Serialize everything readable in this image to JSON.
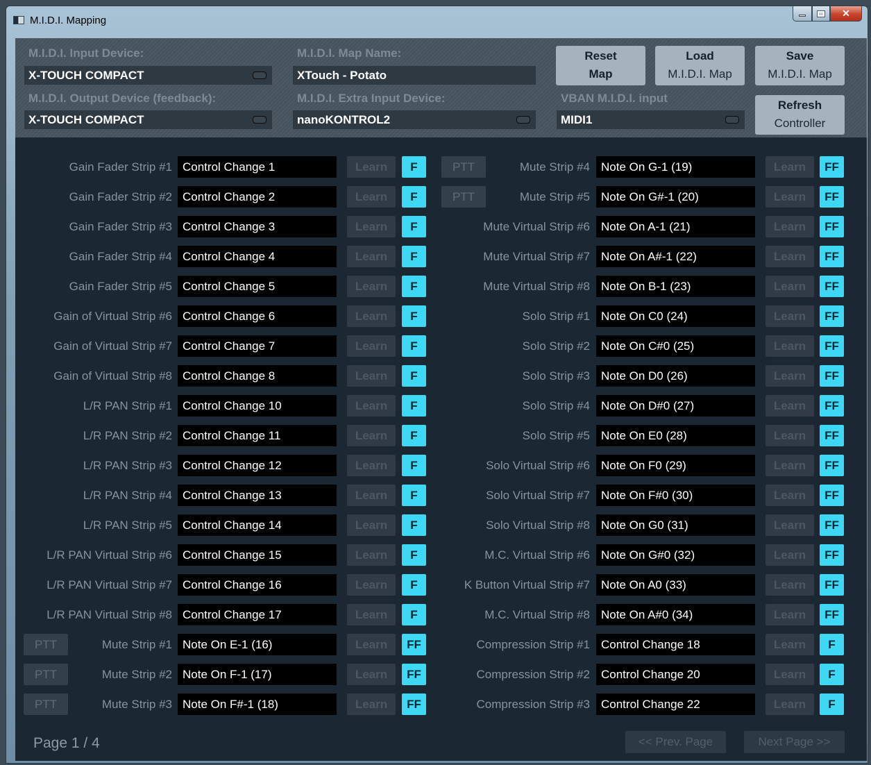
{
  "window": {
    "title": "M.I.D.I. Mapping"
  },
  "top": {
    "input_label": "M.I.D.I. Input Device:",
    "input_value": "X-TOUCH COMPACT",
    "output_label": "M.I.D.I. Output Device (feedback):",
    "output_value": "X-TOUCH COMPACT",
    "mapname_label": "M.I.D.I. Map Name:",
    "mapname_value": "XTouch - Potato",
    "extra_label": "M.I.D.I. Extra Input Device:",
    "extra_value": "nanoKONTROL2",
    "vban_label": "VBAN M.I.D.I. input",
    "vban_value": "MIDI1",
    "reset": {
      "l1": "Reset",
      "l2": "Map"
    },
    "load": {
      "l1": "Load",
      "l2": "M.I.D.I. Map"
    },
    "save": {
      "l1": "Save",
      "l2": "M.I.D.I. Map"
    },
    "refresh": {
      "l1": "Refresh",
      "l2": "Controller"
    }
  },
  "learn_label": "Learn",
  "ptt_label": "PTT",
  "left": [
    {
      "label": "Gain Fader Strip #1",
      "value": "Control Change 1",
      "flag": "F",
      "ptt": false
    },
    {
      "label": "Gain Fader Strip #2",
      "value": "Control Change 2",
      "flag": "F",
      "ptt": false
    },
    {
      "label": "Gain Fader Strip #3",
      "value": "Control Change 3",
      "flag": "F",
      "ptt": false
    },
    {
      "label": "Gain Fader Strip #4",
      "value": "Control Change 4",
      "flag": "F",
      "ptt": false
    },
    {
      "label": "Gain Fader Strip #5",
      "value": "Control Change 5",
      "flag": "F",
      "ptt": false
    },
    {
      "label": "Gain of Virtual Strip #6",
      "value": "Control Change 6",
      "flag": "F",
      "ptt": false
    },
    {
      "label": "Gain of Virtual Strip #7",
      "value": "Control Change 7",
      "flag": "F",
      "ptt": false
    },
    {
      "label": "Gain of Virtual Strip #8",
      "value": "Control Change 8",
      "flag": "F",
      "ptt": false
    },
    {
      "label": "L/R PAN Strip #1",
      "value": "Control Change 10",
      "flag": "F",
      "ptt": false
    },
    {
      "label": "L/R PAN Strip #2",
      "value": "Control Change 11",
      "flag": "F",
      "ptt": false
    },
    {
      "label": "L/R PAN Strip #3",
      "value": "Control Change 12",
      "flag": "F",
      "ptt": false
    },
    {
      "label": "L/R PAN Strip #4",
      "value": "Control Change 13",
      "flag": "F",
      "ptt": false
    },
    {
      "label": "L/R PAN Strip #5",
      "value": "Control Change 14",
      "flag": "F",
      "ptt": false
    },
    {
      "label": "L/R PAN Virtual Strip #6",
      "value": "Control Change 15",
      "flag": "F",
      "ptt": false
    },
    {
      "label": "L/R PAN Virtual Strip #7",
      "value": "Control Change 16",
      "flag": "F",
      "ptt": false
    },
    {
      "label": "L/R PAN Virtual Strip #8",
      "value": "Control Change 17",
      "flag": "F",
      "ptt": false
    },
    {
      "label": "Mute Strip #1",
      "value": "Note On E-1 (16)",
      "flag": "FF",
      "ptt": true
    },
    {
      "label": "Mute Strip #2",
      "value": "Note On F-1 (17)",
      "flag": "FF",
      "ptt": true
    },
    {
      "label": "Mute Strip #3",
      "value": "Note On F#-1 (18)",
      "flag": "FF",
      "ptt": true
    }
  ],
  "right": [
    {
      "label": "Mute Strip #4",
      "value": "Note On G-1 (19)",
      "flag": "FF",
      "ptt": true
    },
    {
      "label": "Mute Strip #5",
      "value": "Note On G#-1 (20)",
      "flag": "FF",
      "ptt": true
    },
    {
      "label": "Mute Virtual Strip #6",
      "value": "Note On A-1 (21)",
      "flag": "FF",
      "ptt": false
    },
    {
      "label": "Mute Virtual Strip #7",
      "value": "Note On A#-1 (22)",
      "flag": "FF",
      "ptt": false
    },
    {
      "label": "Mute Virtual Strip #8",
      "value": "Note On B-1 (23)",
      "flag": "FF",
      "ptt": false
    },
    {
      "label": "Solo Strip #1",
      "value": "Note On C0 (24)",
      "flag": "FF",
      "ptt": false
    },
    {
      "label": "Solo Strip #2",
      "value": "Note On C#0 (25)",
      "flag": "FF",
      "ptt": false
    },
    {
      "label": "Solo Strip #3",
      "value": "Note On D0 (26)",
      "flag": "FF",
      "ptt": false
    },
    {
      "label": "Solo Strip #4",
      "value": "Note On D#0 (27)",
      "flag": "FF",
      "ptt": false
    },
    {
      "label": "Solo Strip #5",
      "value": "Note On E0 (28)",
      "flag": "FF",
      "ptt": false
    },
    {
      "label": "Solo Virtual Strip #6",
      "value": "Note On F0 (29)",
      "flag": "FF",
      "ptt": false
    },
    {
      "label": "Solo Virtual Strip #7",
      "value": "Note On F#0 (30)",
      "flag": "FF",
      "ptt": false
    },
    {
      "label": "Solo Virtual Strip #8",
      "value": "Note On G0 (31)",
      "flag": "FF",
      "ptt": false
    },
    {
      "label": "M.C. Virtual Strip #6",
      "value": "Note On G#0 (32)",
      "flag": "FF",
      "ptt": false
    },
    {
      "label": "K Button Virtual Strip #7",
      "value": "Note On A0 (33)",
      "flag": "FF",
      "ptt": false
    },
    {
      "label": "M.C. Virtual Strip #8",
      "value": "Note On A#0 (34)",
      "flag": "FF",
      "ptt": false
    },
    {
      "label": "Compression Strip #1",
      "value": "Control Change 18",
      "flag": "F",
      "ptt": false
    },
    {
      "label": "Compression Strip #2",
      "value": "Control Change 20",
      "flag": "F",
      "ptt": false
    },
    {
      "label": "Compression Strip #3",
      "value": "Control Change 22",
      "flag": "F",
      "ptt": false
    }
  ],
  "footer": {
    "page": "Page 1 / 4",
    "prev": "<< Prev. Page",
    "next": "Next Page >>"
  }
}
